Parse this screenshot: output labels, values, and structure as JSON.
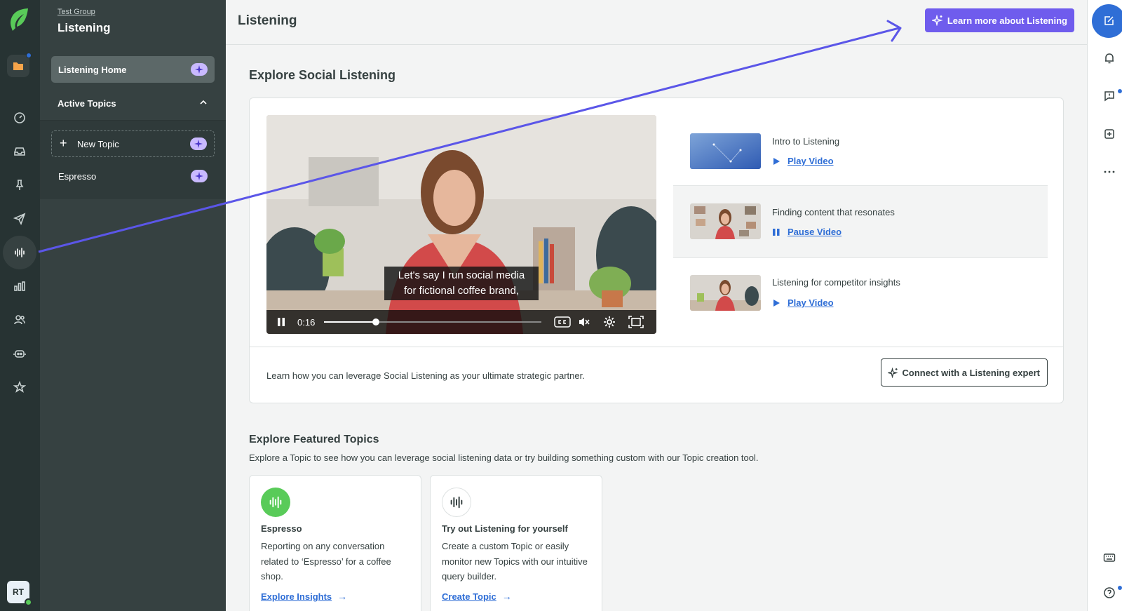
{
  "colors": {
    "rail_bg": "#273333",
    "subnav_bg": "#364141",
    "accent_purple": "#6f5ced",
    "link_blue": "#2f6ed6",
    "brand_green": "#59cb59"
  },
  "rail": {
    "logo": "sprout-leaf-logo",
    "items": [
      "folder-icon",
      "dashboard-icon",
      "inbox-icon",
      "pin-icon",
      "send-icon",
      "listening-icon",
      "reports-icon",
      "people-icon",
      "bot-icon",
      "star-icon"
    ],
    "active": "listening-icon",
    "avatar_initials": "RT"
  },
  "subnav": {
    "group_link": "Test Group",
    "section_title": "Listening",
    "home_label": "Listening Home",
    "active_topics_label": "Active Topics",
    "new_topic_label": "New Topic",
    "topics": [
      "Espresso"
    ]
  },
  "header": {
    "title": "Listening",
    "learn_button": "Learn more about Listening"
  },
  "explore": {
    "title": "Explore Social Listening",
    "video": {
      "caption_line1": "Let's say I run social media",
      "caption_line2": "for fictional coffee brand,",
      "time": "0:16",
      "progress": 0.24
    },
    "videos": [
      {
        "title": "Intro to Listening",
        "action": "Play Video"
      },
      {
        "title": "Finding content that resonates",
        "action": "Pause Video"
      },
      {
        "title": "Listening for competitor insights",
        "action": "Play Video"
      }
    ],
    "footer_text": "Learn how you can leverage Social Listening as your ultimate strategic partner.",
    "connect_button": "Connect with a Listening expert"
  },
  "featured": {
    "title": "Explore Featured Topics",
    "description": "Explore a Topic to see how you can leverage social listening data or try building something custom with our Topic creation tool.",
    "cards": [
      {
        "title": "Espresso",
        "body": "Reporting on any conversation related to ‘Espresso’ for a coffee shop.",
        "link": "Explore Insights"
      },
      {
        "title": "Try out Listening for yourself",
        "body": "Create a custom Topic or easily monitor new Topics with our intuitive query builder.",
        "link": "Create Topic"
      }
    ]
  },
  "right_rail": {
    "items": [
      "compose-icon",
      "bell-icon",
      "feedback-icon",
      "add-icon",
      "more-icon",
      "keyboard-icon",
      "help-icon"
    ]
  }
}
